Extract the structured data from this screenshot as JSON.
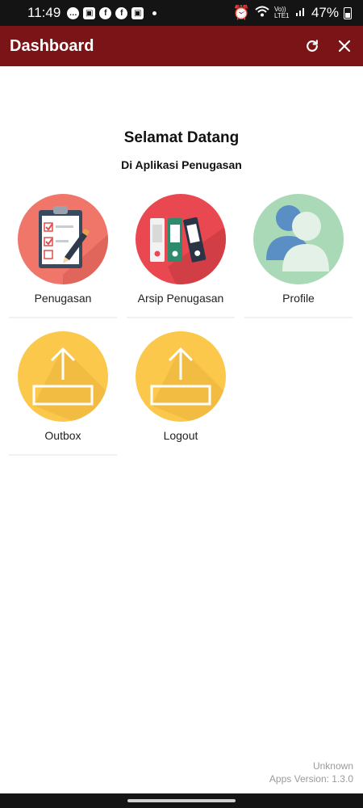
{
  "status_bar": {
    "time": "11:49",
    "battery": "47%",
    "network": "Vo)) LTE1"
  },
  "app_bar": {
    "title": "Dashboard",
    "bg_color": "#7a1416",
    "refresh_icon": "refresh-icon",
    "close_icon": "close-icon"
  },
  "welcome": {
    "title": "Selamat Datang",
    "subtitle": "Di Aplikasi Penugasan"
  },
  "menu": [
    {
      "label": "Penugasan",
      "icon": "clipboard-checklist-icon",
      "circle_color": "#f1766a"
    },
    {
      "label": "Arsip Penugasan",
      "icon": "binders-icon",
      "circle_color": "#e94850"
    },
    {
      "label": "Profile",
      "icon": "users-icon",
      "circle_color": "#a9d9b6"
    },
    {
      "label": "Outbox",
      "icon": "upload-icon",
      "circle_color": "#fbc84b"
    },
    {
      "label": "Logout",
      "icon": "upload-icon",
      "circle_color": "#fbc84b"
    }
  ],
  "footer": {
    "line1": "Unknown",
    "line2": "Apps Version: 1.3.0"
  }
}
